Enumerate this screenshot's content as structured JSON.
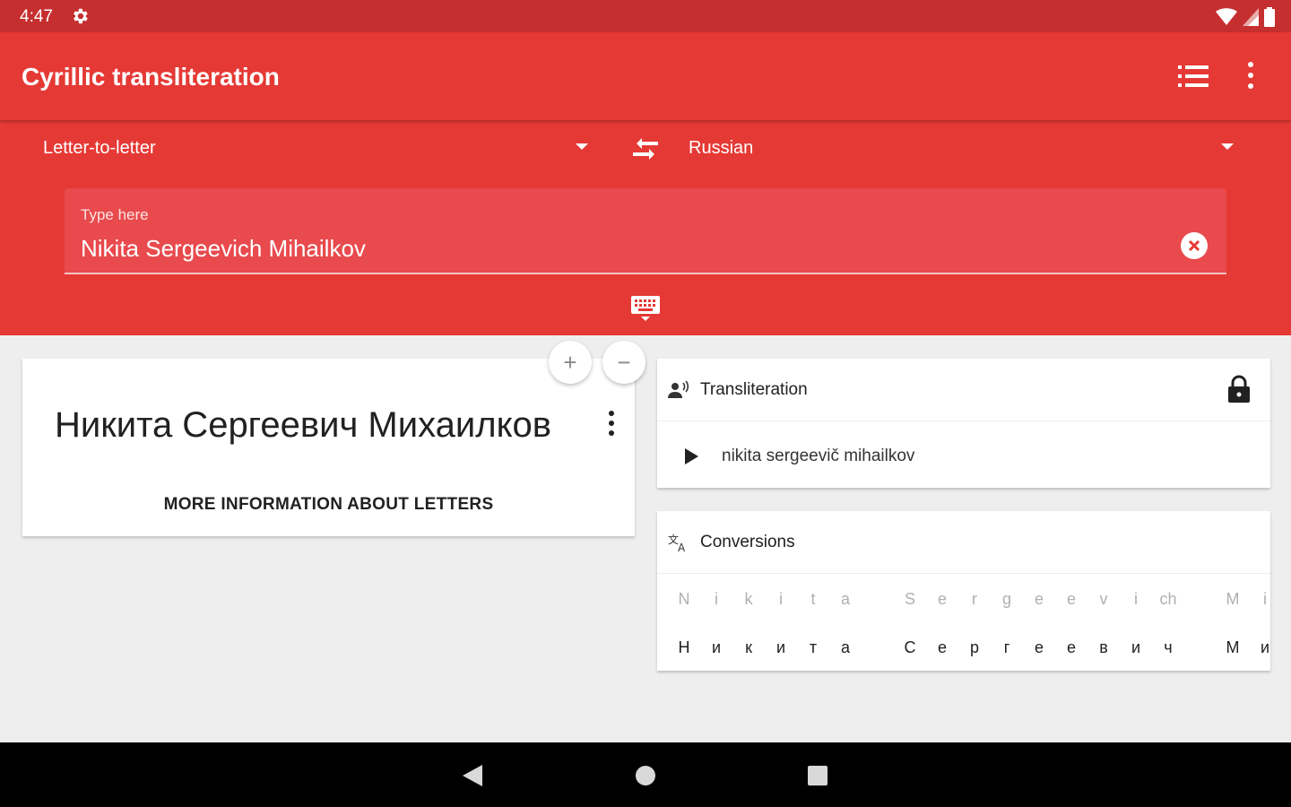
{
  "status_bar": {
    "time": "4:47"
  },
  "app_bar": {
    "title": "Cyrillic transliteration"
  },
  "controls": {
    "mode": "Letter-to-letter",
    "language": "Russian",
    "input_label": "Type here",
    "input_value": "Nikita Sergeevich Mihailkov"
  },
  "result_card": {
    "cyrillic_text": "Никита Сергеевич Михаилков",
    "more_info_label": "MORE INFORMATION ABOUT LETTERS"
  },
  "zoom": {
    "in_label": "+",
    "out_label": "−"
  },
  "transliteration_card": {
    "title": "Transliteration",
    "text": "nikita sergeevič mihailkov"
  },
  "conversions_card": {
    "title": "Conversions",
    "pairs": [
      {
        "latin": "N",
        "cyr": "Н"
      },
      {
        "latin": "i",
        "cyr": "и"
      },
      {
        "latin": "k",
        "cyr": "к"
      },
      {
        "latin": "i",
        "cyr": "и"
      },
      {
        "latin": "t",
        "cyr": "т"
      },
      {
        "latin": "a",
        "cyr": "а"
      },
      {
        "latin": "S",
        "cyr": "С"
      },
      {
        "latin": "e",
        "cyr": "е"
      },
      {
        "latin": "r",
        "cyr": "р"
      },
      {
        "latin": "g",
        "cyr": "г"
      },
      {
        "latin": "e",
        "cyr": "е"
      },
      {
        "latin": "e",
        "cyr": "е"
      },
      {
        "latin": "v",
        "cyr": "в"
      },
      {
        "latin": "i",
        "cyr": "и"
      },
      {
        "latin": "ch",
        "cyr": "ч"
      },
      {
        "latin": "M",
        "cyr": "М"
      },
      {
        "latin": "i",
        "cyr": "и"
      }
    ]
  },
  "colors": {
    "primary": "#e53935",
    "status": "#c62f2f",
    "input_fill": "#e84a4d"
  },
  "icons": [
    "gear-icon",
    "wifi-icon",
    "signal-icon",
    "battery-icon",
    "list-icon",
    "more-vert-icon",
    "swap-icon",
    "clear-icon",
    "keyboard-icon",
    "person-voice-icon",
    "lock-icon",
    "play-icon",
    "translate-icon",
    "back-icon",
    "home-icon",
    "recents-icon"
  ]
}
